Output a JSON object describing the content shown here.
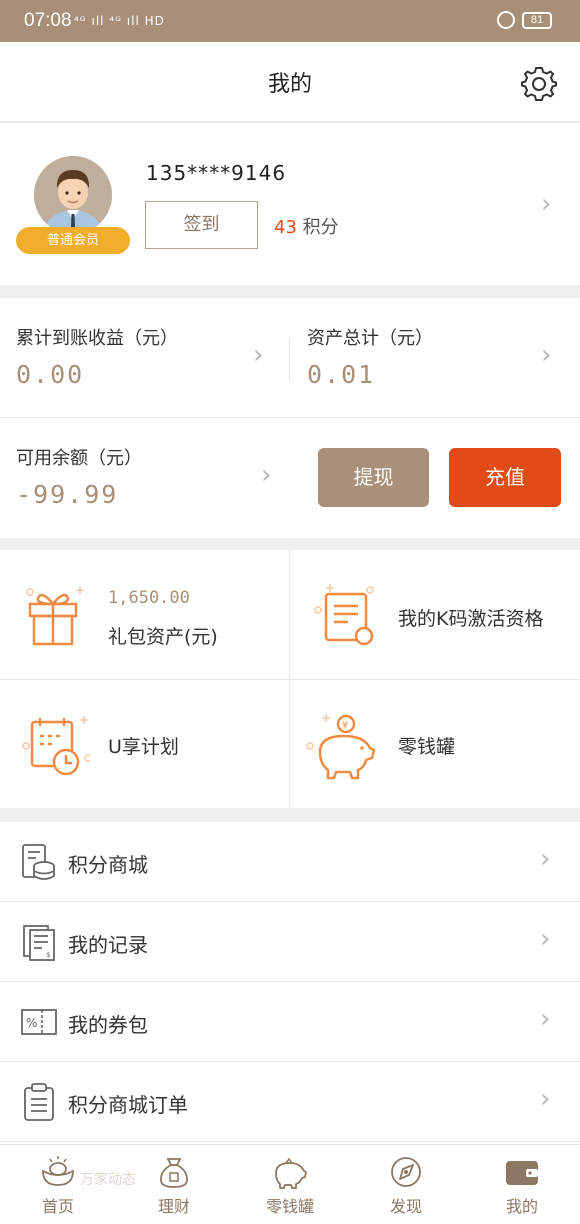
{
  "status_bar": {
    "time": "07:08",
    "signal": "⁴ᴳ ıll ⁴ᴳ ıll HD",
    "battery": "81"
  },
  "header": {
    "title": "我的"
  },
  "profile": {
    "phone": "135****9146",
    "member_level": "普通会员",
    "sign_in_label": "签到",
    "points_value": "43",
    "points_unit": "积分"
  },
  "assets": {
    "cumulative_label": "累计到账收益（元）",
    "cumulative_value": "0.00",
    "total_label": "资产总计（元）",
    "total_value": "0.01",
    "balance_label": "可用余额（元）",
    "balance_value": "-99.99",
    "withdraw_label": "提现",
    "recharge_label": "充值"
  },
  "grid": {
    "gift_amount": "1,650.00",
    "gift_label": "礼包资产(元)",
    "kcode_label": "我的K码激活资格",
    "uplan_label": "U享计划",
    "piggy_label": "零钱罐"
  },
  "menu": [
    {
      "label": "积分商城",
      "icon": "coins-icon"
    },
    {
      "label": "我的记录",
      "icon": "records-icon"
    },
    {
      "label": "我的券包",
      "icon": "coupon-icon"
    },
    {
      "label": "积分商城订单",
      "icon": "clipboard-icon"
    }
  ],
  "tabbar": {
    "tabs": [
      {
        "label": "首页",
        "icon": "ingot-icon"
      },
      {
        "label": "理财",
        "icon": "money-bag-icon"
      },
      {
        "label": "零钱罐",
        "icon": "piggy-bank-icon"
      },
      {
        "label": "发现",
        "icon": "compass-icon"
      },
      {
        "label": "我的",
        "icon": "wallet-icon"
      }
    ],
    "watermark": "万家动态"
  },
  "colors": {
    "brand_brown": "#a88f77",
    "accent_orange": "#e04b17",
    "icon_orange": "#ef8a43",
    "badge_yellow": "#f2ad2a"
  }
}
